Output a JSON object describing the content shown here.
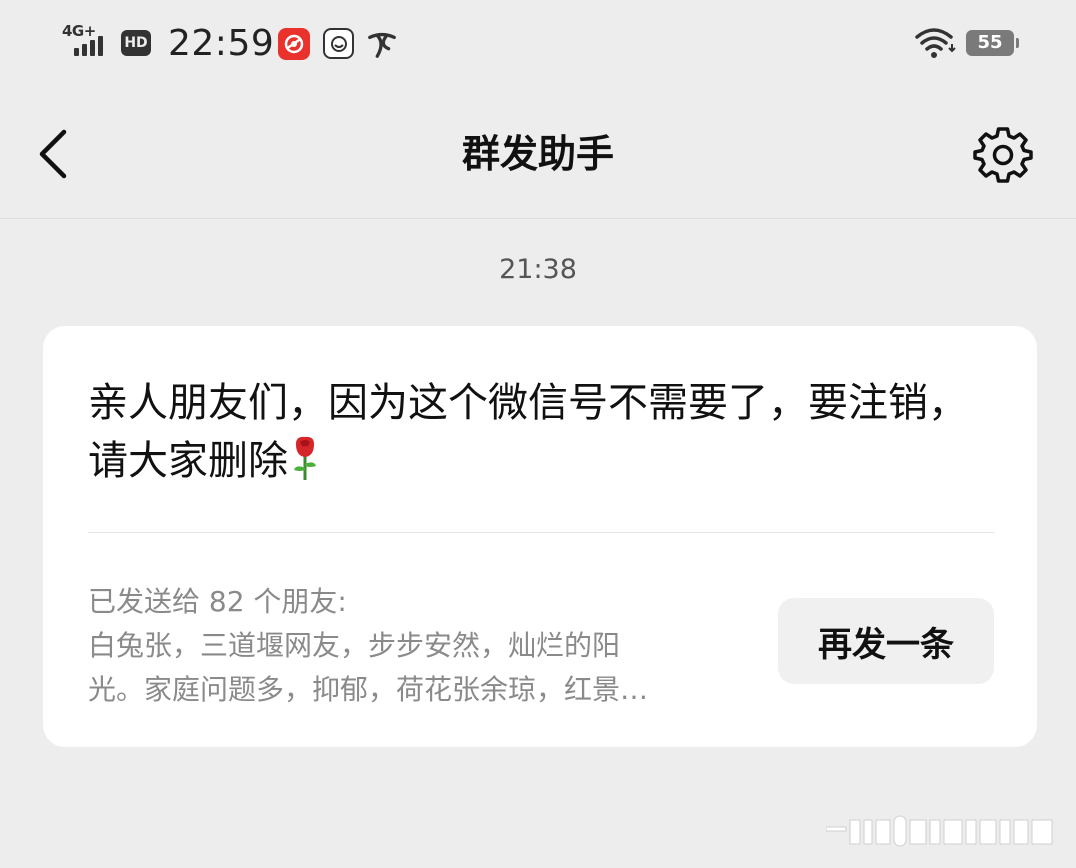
{
  "status_bar": {
    "network": "4G+",
    "hd": "HD",
    "time": "22:59",
    "battery": "55",
    "icons": [
      "signal-icon",
      "hd-icon",
      "app-icon",
      "smile-app-icon",
      "telecom-icon",
      "wifi-icon",
      "battery-icon"
    ]
  },
  "nav": {
    "title": "群发助手",
    "back_icon": "chevron-left-icon",
    "settings_icon": "gear-icon"
  },
  "chat": {
    "timestamp": "21:38",
    "message_text": "亲人朋友们，因为这个微信号不需要了，要注销，请大家删除",
    "message_emoji": "rose-icon",
    "recipients_header": "已发送给  82  个朋友:",
    "recipients_line1": "白兔张，三道堰网友，步步安然，灿烂的阳",
    "recipients_line2": "光。家庭问题多，抑郁，荷花张余琼，红景…",
    "resend_label": "再发一条"
  },
  "colors": {
    "background": "#ededed",
    "card": "#ffffff",
    "secondary_text": "#8a8a8a",
    "button_bg": "#f0f0f0"
  }
}
